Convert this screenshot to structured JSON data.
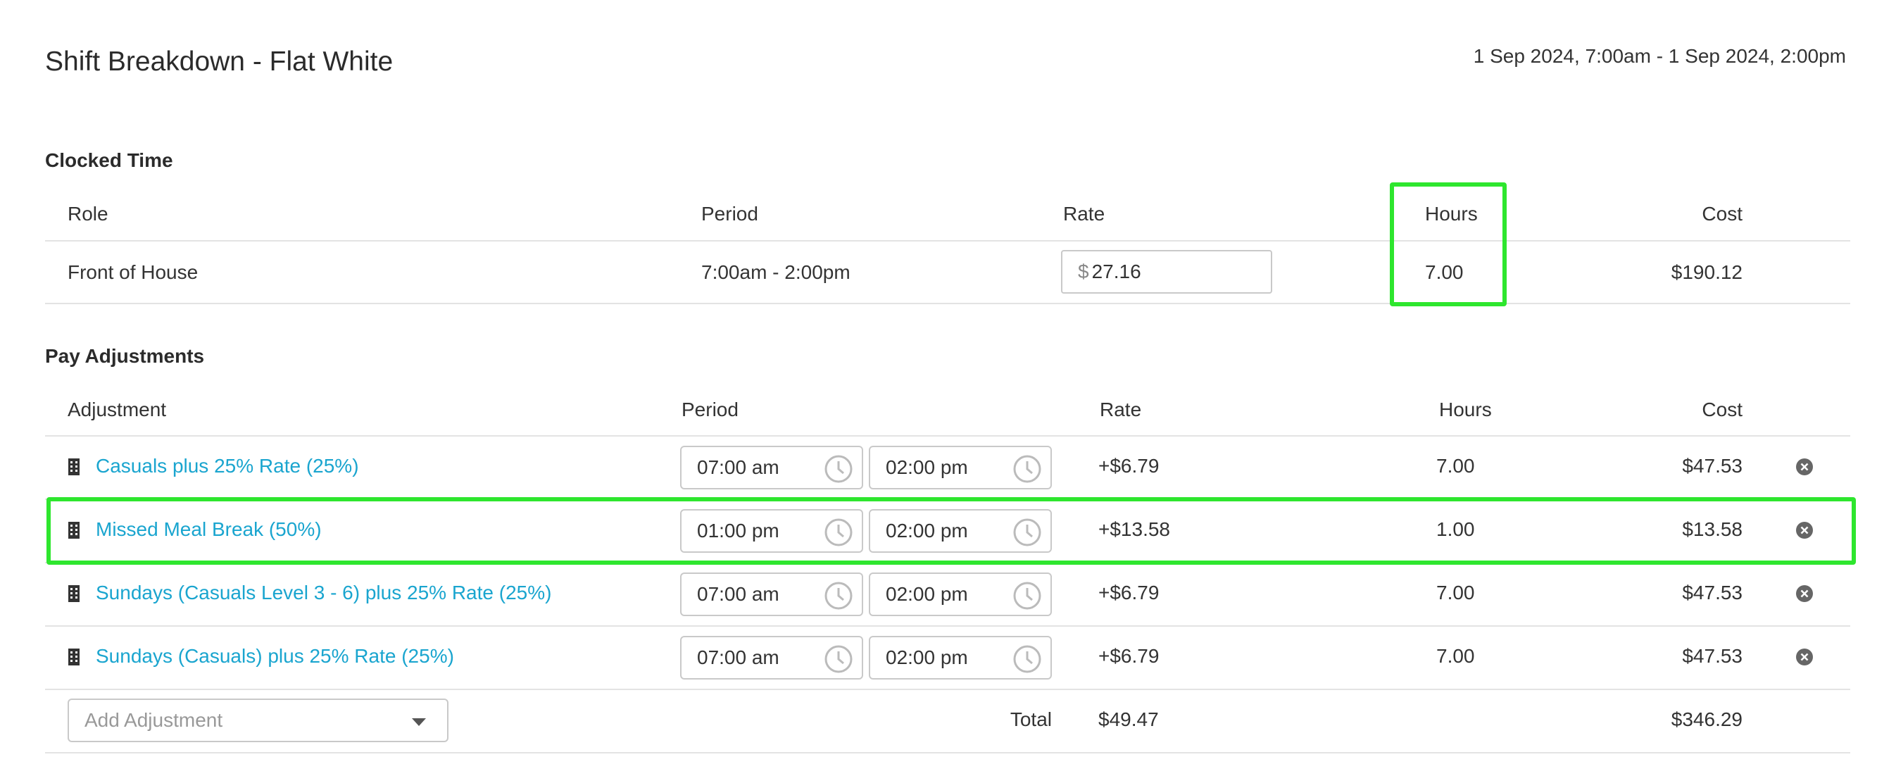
{
  "page": {
    "title": "Shift Breakdown - Flat White",
    "date_range": "1 Sep 2024, 7:00am - 1 Sep 2024, 2:00pm"
  },
  "clocked": {
    "section_title": "Clocked Time",
    "headers": {
      "role": "Role",
      "period": "Period",
      "rate": "Rate",
      "hours": "Hours",
      "cost": "Cost"
    },
    "row": {
      "role": "Front of House",
      "period": "7:00am - 2:00pm",
      "rate_currency": "$",
      "rate_value": "27.16",
      "hours": "7.00",
      "cost": "$190.12"
    }
  },
  "adjustments": {
    "section_title": "Pay Adjustments",
    "headers": {
      "adjustment": "Adjustment",
      "period": "Period",
      "rate": "Rate",
      "hours": "Hours",
      "cost": "Cost"
    },
    "rows": [
      {
        "name": "Casuals plus 25% Rate (25%)",
        "start": "07:00 am",
        "end": "02:00 pm",
        "rate": "+$6.79",
        "hours": "7.00",
        "cost": "$47.53"
      },
      {
        "name": "Missed Meal Break (50%)",
        "start": "01:00 pm",
        "end": "02:00 pm",
        "rate": "+$13.58",
        "hours": "1.00",
        "cost": "$13.58"
      },
      {
        "name": "Sundays (Casuals Level 3 - 6) plus 25% Rate (25%)",
        "start": "07:00 am",
        "end": "02:00 pm",
        "rate": "+$6.79",
        "hours": "7.00",
        "cost": "$47.53"
      },
      {
        "name": "Sundays (Casuals) plus 25% Rate (25%)",
        "start": "07:00 am",
        "end": "02:00 pm",
        "rate": "+$6.79",
        "hours": "7.00",
        "cost": "$47.53"
      }
    ],
    "add_placeholder": "Add Adjustment",
    "total_label": "Total",
    "total_rate": "$49.47",
    "total_cost": "$346.29"
  },
  "colors": {
    "link": "#1aa5cf",
    "highlight": "#2ee62e"
  },
  "icons": {
    "row_type": "document-icon",
    "time": "clock-icon",
    "remove": "close-circle-icon",
    "dropdown": "caret-down-icon"
  }
}
